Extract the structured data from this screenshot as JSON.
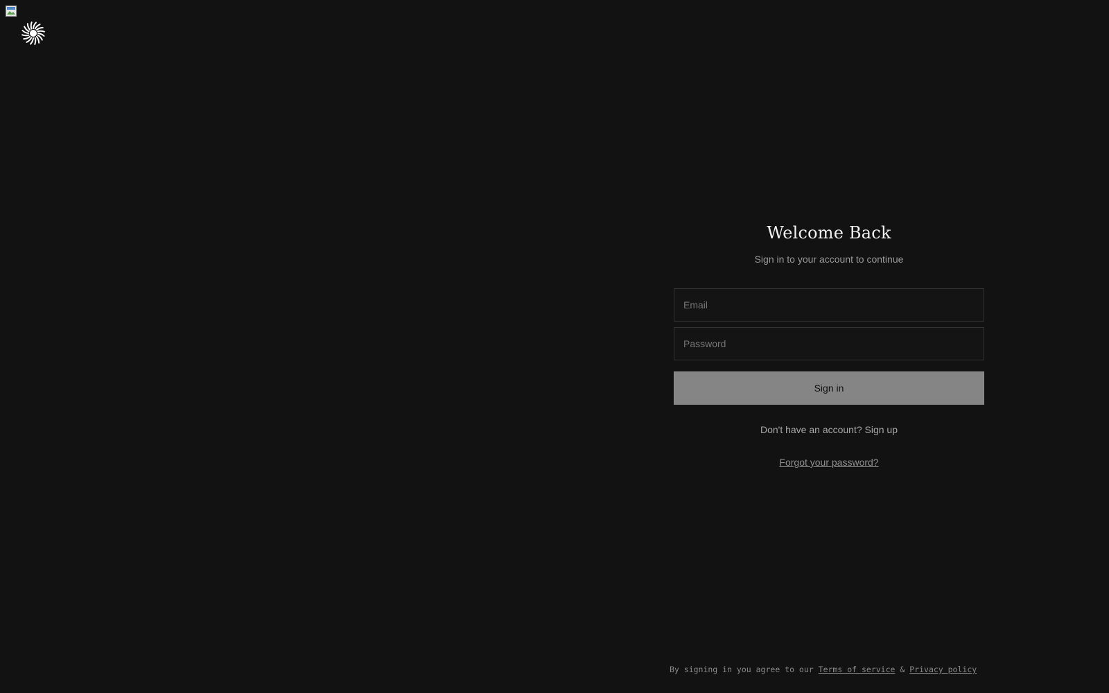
{
  "header": {
    "logo_icon": "sunburst-logo-icon"
  },
  "login": {
    "title": "Welcome Back",
    "subtitle": "Sign in to your account to continue",
    "email_placeholder": "Email",
    "password_placeholder": "Password",
    "signin_label": "Sign in",
    "signup_text": "Don't have an account? Sign up",
    "forgot_text": "Forgot your password?"
  },
  "footer": {
    "prefix": "By signing in you agree to our",
    "terms_label": "Terms of service",
    "separator": "&",
    "privacy_label": "Privacy policy"
  },
  "colors": {
    "background": "#121212",
    "button": "#858585",
    "input_border": "#343434"
  }
}
